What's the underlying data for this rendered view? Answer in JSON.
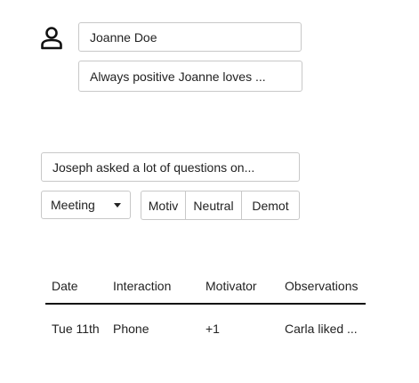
{
  "profile": {
    "avatar_icon": "person-icon",
    "name_value": "Joanne Doe",
    "description_value": "Always positive Joanne loves ..."
  },
  "interaction": {
    "note_value": "Joseph asked a lot of questions on...",
    "type_select": {
      "selected": "Meeting"
    },
    "motivation": [
      "Motiv",
      "Neutral",
      "Demot"
    ]
  },
  "table": {
    "headers": [
      "Date",
      "Interaction",
      "Motivator",
      "Observations"
    ],
    "rows": [
      [
        "Tue 11th",
        "Phone",
        "+1",
        "Carla liked ..."
      ]
    ]
  }
}
